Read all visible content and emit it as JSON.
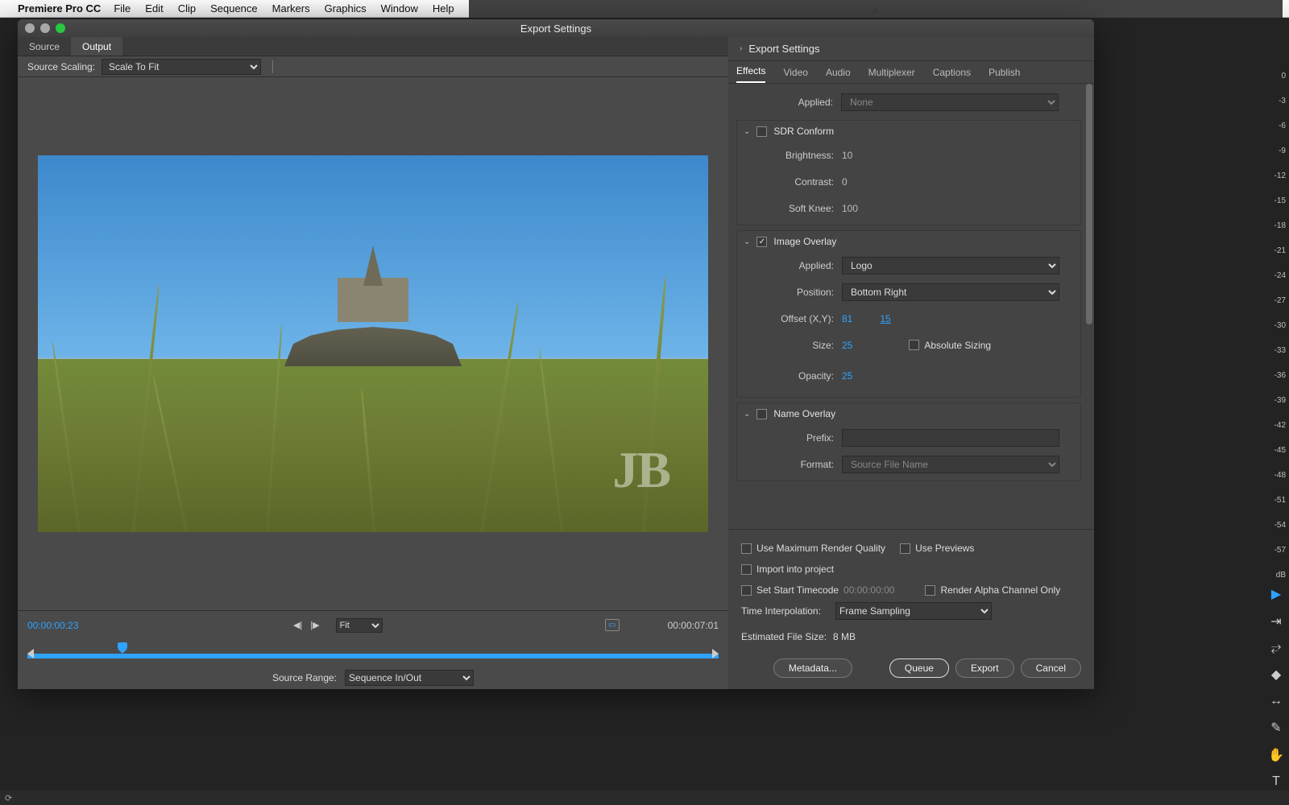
{
  "menubar": {
    "app": "Premiere Pro CC",
    "items": [
      "File",
      "Edit",
      "Clip",
      "Sequence",
      "Markers",
      "Graphics",
      "Window",
      "Help"
    ]
  },
  "dialog": {
    "title": "Export Settings",
    "leftTabs": {
      "source": "Source",
      "output": "Output"
    },
    "sourceScaling": {
      "label": "Source Scaling:",
      "value": "Scale To Fit"
    },
    "watermark": "JB",
    "transport": {
      "current": "00:00:00:23",
      "fit": "Fit",
      "duration": "00:00:07:01"
    },
    "sourceRange": {
      "label": "Source Range:",
      "value": "Sequence In/Out"
    },
    "sectionTitle": "Export Settings",
    "tabs": [
      "Effects",
      "Video",
      "Audio",
      "Multiplexer",
      "Captions",
      "Publish"
    ],
    "applied": {
      "label": "Applied:",
      "value": "None"
    },
    "sdr": {
      "title": "SDR Conform",
      "brightness": {
        "label": "Brightness:",
        "value": "10"
      },
      "contrast": {
        "label": "Contrast:",
        "value": "0"
      },
      "softknee": {
        "label": "Soft Knee:",
        "value": "100"
      }
    },
    "imageOverlay": {
      "title": "Image Overlay",
      "applied": {
        "label": "Applied:",
        "value": "Logo"
      },
      "position": {
        "label": "Position:",
        "value": "Bottom Right"
      },
      "offset": {
        "label": "Offset (X,Y):",
        "x": "81",
        "y": "15"
      },
      "size": {
        "label": "Size:",
        "value": "25"
      },
      "absolute": "Absolute Sizing",
      "opacity": {
        "label": "Opacity:",
        "value": "25"
      }
    },
    "nameOverlay": {
      "title": "Name Overlay",
      "prefix": {
        "label": "Prefix:"
      },
      "format": {
        "label": "Format:",
        "value": "Source File Name"
      }
    },
    "bottom": {
      "maxQuality": "Use Maximum Render Quality",
      "usePreviews": "Use Previews",
      "importProject": "Import into project",
      "setStartTC": "Set Start Timecode",
      "startTC": "00:00:00:00",
      "alphaOnly": "Render Alpha Channel Only",
      "timeInterp": {
        "label": "Time Interpolation:",
        "value": "Frame Sampling"
      },
      "estLabel": "Estimated File Size:",
      "estValue": "8 MB"
    },
    "buttons": {
      "metadata": "Metadata...",
      "queue": "Queue",
      "export": "Export",
      "cancel": "Cancel"
    }
  },
  "dbTicks": [
    "0",
    "-3",
    "-6",
    "-9",
    "-12",
    "-15",
    "-18",
    "-21",
    "-24",
    "-27",
    "-30",
    "-33",
    "-36",
    "-39",
    "-42",
    "-45",
    "-48",
    "-51",
    "-54",
    "-57",
    "dB"
  ]
}
